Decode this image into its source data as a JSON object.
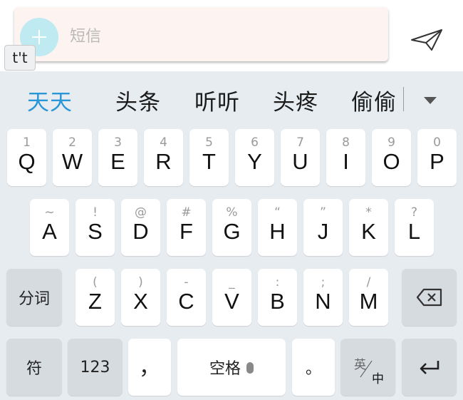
{
  "composer": {
    "placeholder": "短信",
    "floating_label": "t't"
  },
  "candidates": [
    "天天",
    "头条",
    "听听",
    "头疼",
    "偷偷"
  ],
  "row1": [
    {
      "hint": "1",
      "main": "Q"
    },
    {
      "hint": "2",
      "main": "W"
    },
    {
      "hint": "3",
      "main": "E"
    },
    {
      "hint": "4",
      "main": "R"
    },
    {
      "hint": "5",
      "main": "T"
    },
    {
      "hint": "6",
      "main": "Y"
    },
    {
      "hint": "7",
      "main": "U"
    },
    {
      "hint": "8",
      "main": "I"
    },
    {
      "hint": "9",
      "main": "O"
    },
    {
      "hint": "0",
      "main": "P"
    }
  ],
  "row2": [
    {
      "hint": "~",
      "main": "A"
    },
    {
      "hint": "!",
      "main": "S"
    },
    {
      "hint": "@",
      "main": "D"
    },
    {
      "hint": "#",
      "main": "F"
    },
    {
      "hint": "%",
      "main": "G"
    },
    {
      "hint": "“",
      "main": "H"
    },
    {
      "hint": "”",
      "main": "J"
    },
    {
      "hint": "*",
      "main": "K"
    },
    {
      "hint": "?",
      "main": "L"
    }
  ],
  "row3": [
    {
      "hint": "(",
      "main": "Z"
    },
    {
      "hint": ")",
      "main": "X"
    },
    {
      "hint": "-",
      "main": "C"
    },
    {
      "hint": "_",
      "main": "V"
    },
    {
      "hint": ":",
      "main": "B"
    },
    {
      "hint": ";",
      "main": "N"
    },
    {
      "hint": "/",
      "main": "M"
    }
  ],
  "keys": {
    "segment": "分词",
    "symbols": "符",
    "numbers": "123",
    "comma": "，",
    "space": "空格",
    "period": "。",
    "lang_top": "英",
    "lang_bottom": "中"
  },
  "icons": {
    "send": "paper-plane-icon",
    "add": "plus-icon",
    "backspace": "backspace-icon",
    "enter": "enter-icon",
    "mic": "microphone-icon",
    "expand": "triangle-down-icon"
  },
  "colors": {
    "selected_candidate": "#2996d8",
    "keyboard_bg": "#e7ecf0",
    "function_key": "#d6dbe0"
  }
}
